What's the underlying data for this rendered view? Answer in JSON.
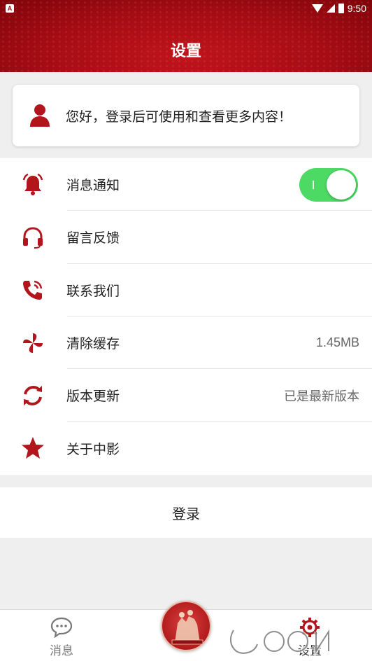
{
  "status_bar": {
    "app_letter": "A",
    "time": "9:50"
  },
  "header": {
    "title": "设置"
  },
  "login_prompt": {
    "message": "您好，登录后可使用和查看更多内容！"
  },
  "settings": [
    {
      "label": "消息通知",
      "icon": "bell-icon",
      "toggle": true
    },
    {
      "label": "留言反馈",
      "icon": "headset-icon"
    },
    {
      "label": "联系我们",
      "icon": "phone-icon"
    },
    {
      "label": "清除缓存",
      "icon": "pinwheel-icon",
      "value": "1.45MB"
    },
    {
      "label": "版本更新",
      "icon": "refresh-icon",
      "value": "已是最新版本"
    },
    {
      "label": "关于中影",
      "icon": "star-icon"
    }
  ],
  "login_button": {
    "label": "登录"
  },
  "tabbar": {
    "messages_label": "消息",
    "settings_label": "设置"
  },
  "colors": {
    "brand_red": "#b2151c",
    "toggle_green": "#4cd964"
  }
}
